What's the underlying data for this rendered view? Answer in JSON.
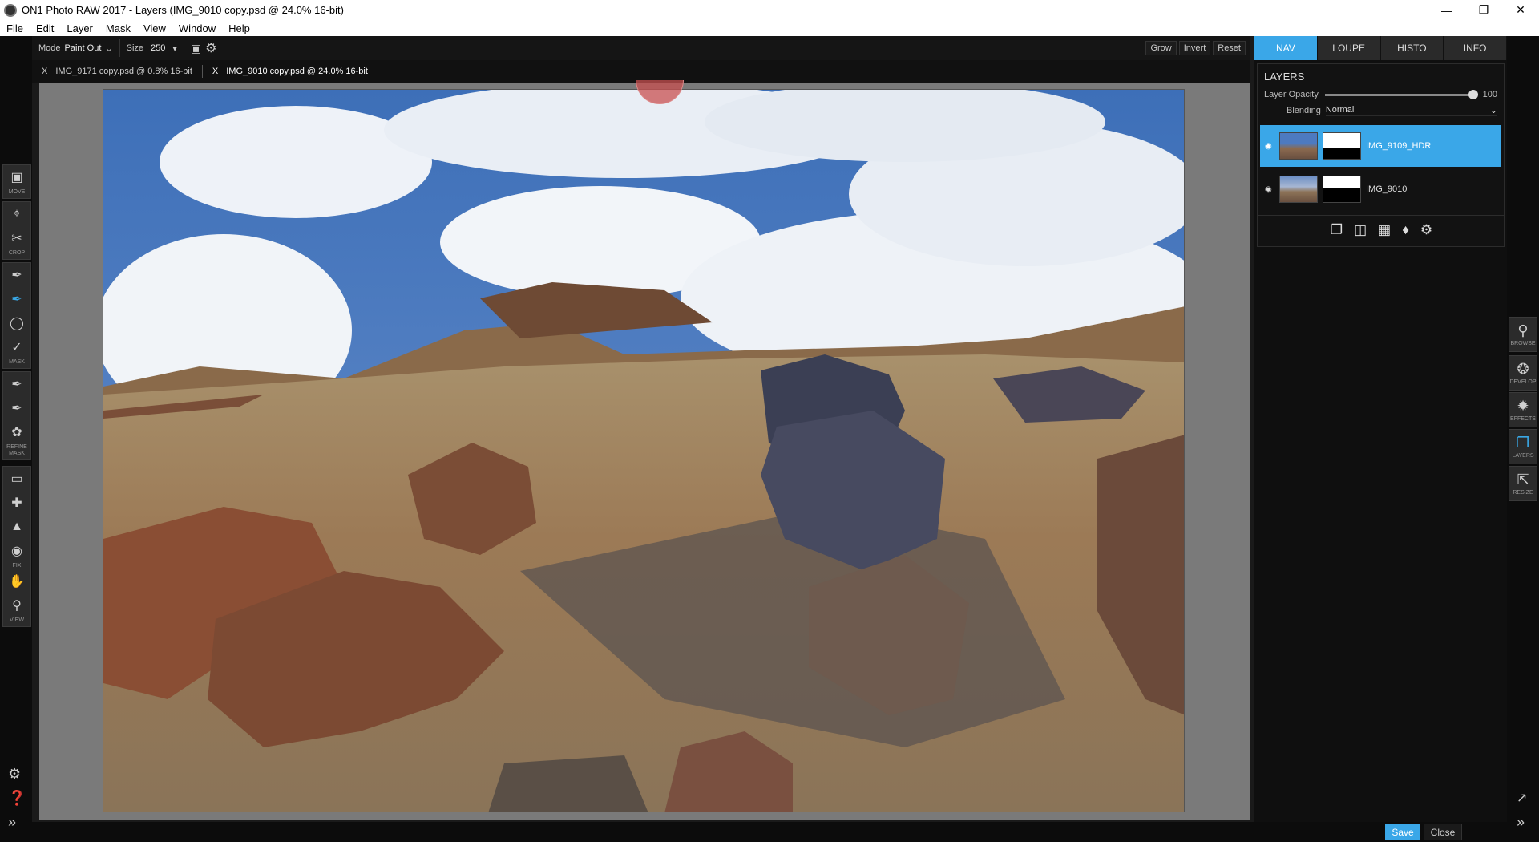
{
  "window": {
    "title": "ON1 Photo RAW 2017 - Layers (IMG_9010 copy.psd @ 24.0% 16-bit)"
  },
  "menu": [
    "File",
    "Edit",
    "Layer",
    "Mask",
    "View",
    "Window",
    "Help"
  ],
  "options": {
    "mode_label": "Mode",
    "mode_value": "Paint Out",
    "size_label": "Size",
    "size_value": "250",
    "grow": "Grow",
    "invert": "Invert",
    "reset": "Reset"
  },
  "doc_tabs": [
    {
      "close": "X",
      "label": "IMG_9171 copy.psd @ 0.8% 16-bit"
    },
    {
      "close": "X",
      "label": "IMG_9010 copy.psd @ 24.0% 16-bit"
    }
  ],
  "toolbar": {
    "labels": {
      "move": "MOVE",
      "crop": "CROP",
      "mask": "MASK",
      "refine": "REFINE MASK",
      "fix": "FIX",
      "view": "VIEW"
    }
  },
  "panel": {
    "tabs": [
      "NAV",
      "LOUPE",
      "HISTO",
      "INFO"
    ],
    "layers_title": "LAYERS",
    "opacity_label": "Layer Opacity",
    "opacity_value": "100",
    "opacity": 1.0,
    "blending_label": "Blending",
    "blending_value": "Normal",
    "layers": [
      {
        "name": "IMG_9109_HDR",
        "selected": true
      },
      {
        "name": "IMG_9010",
        "selected": false
      }
    ]
  },
  "modules": [
    "BROWSE",
    "DEVELOP",
    "EFFECTS",
    "LAYERS",
    "RESIZE"
  ],
  "footer": {
    "save": "Save",
    "close": "Close"
  },
  "colors": {
    "accent": "#3aa7e8"
  }
}
